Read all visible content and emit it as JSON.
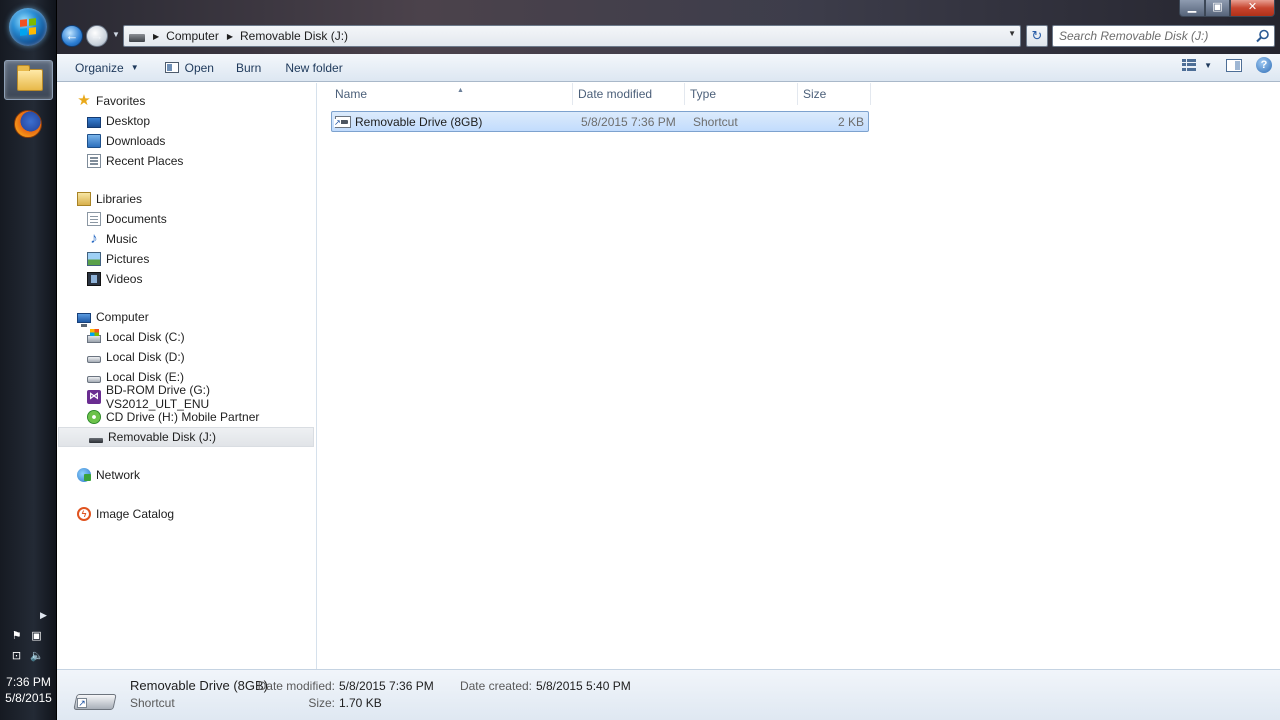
{
  "taskbar": {
    "clock_time": "7:36 PM",
    "clock_date": "5/8/2015"
  },
  "window": {
    "address": {
      "crumbs": [
        "Computer",
        "Removable Disk (J:)"
      ]
    },
    "search": {
      "placeholder": "Search Removable Disk (J:)"
    },
    "toolbar": {
      "organize": "Organize",
      "open": "Open",
      "burn": "Burn",
      "new_folder": "New folder"
    },
    "caption": {
      "minimize": "▁",
      "maximize": "▣",
      "close": "✕"
    }
  },
  "sidebar": {
    "favorites": {
      "label": "Favorites",
      "items": [
        "Desktop",
        "Downloads",
        "Recent Places"
      ]
    },
    "libraries": {
      "label": "Libraries",
      "items": [
        "Documents",
        "Music",
        "Pictures",
        "Videos"
      ]
    },
    "computer": {
      "label": "Computer",
      "items": [
        "Local Disk (C:)",
        "Local Disk (D:)",
        "Local Disk (E:)",
        "BD-ROM Drive (G:) VS2012_ULT_ENU",
        "CD Drive (H:) Mobile Partner",
        "Removable Disk (J:)"
      ],
      "selected_index": 5
    },
    "network": {
      "label": "Network"
    },
    "image_catalog": {
      "label": "Image Catalog"
    }
  },
  "content": {
    "columns": [
      "Name",
      "Date modified",
      "Type",
      "Size"
    ],
    "files": [
      {
        "name": "Removable Drive (8GB)",
        "date_modified": "5/8/2015 7:36 PM",
        "type": "Shortcut",
        "size": "2 KB",
        "selected": true
      }
    ]
  },
  "details": {
    "name": "Removable Drive (8GB)",
    "type": "Shortcut",
    "date_modified_label": "Date modified:",
    "date_modified": "5/8/2015 7:36 PM",
    "size_label": "Size:",
    "size": "1.70 KB",
    "date_created_label": "Date created:",
    "date_created": "5/8/2015 5:40 PM"
  }
}
